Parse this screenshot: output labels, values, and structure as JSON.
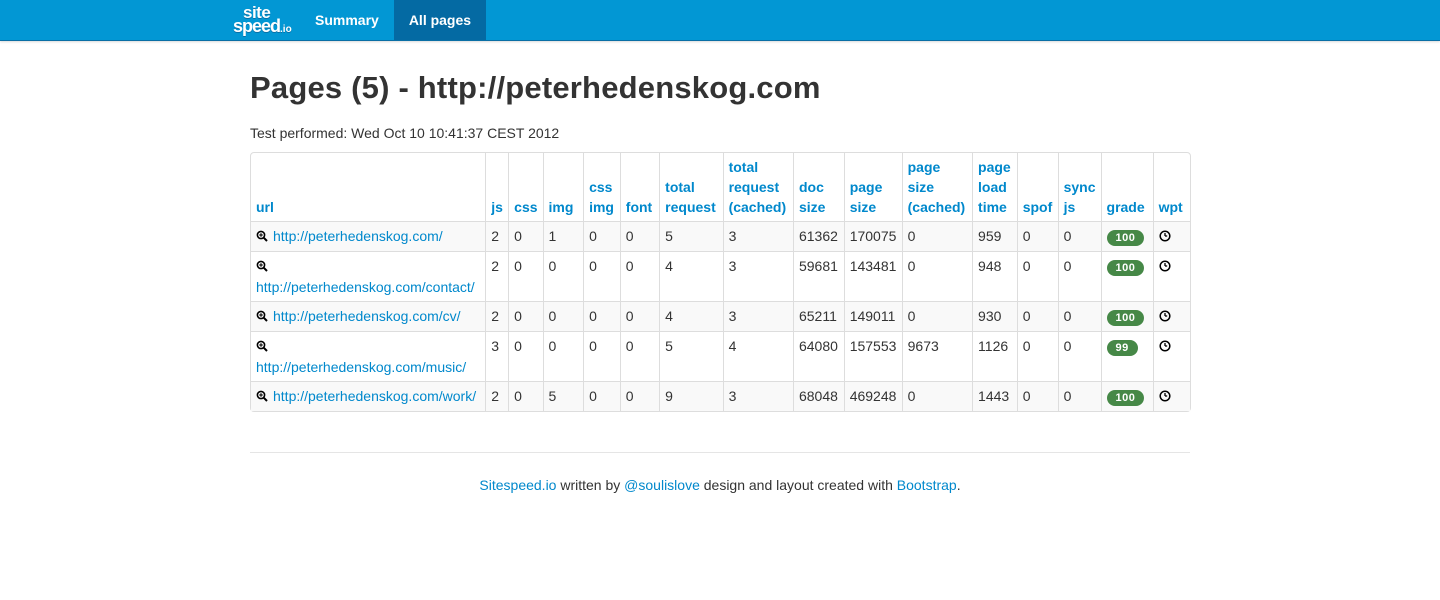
{
  "nav": {
    "brand_line1": "site",
    "brand_line2": "speed",
    "brand_suffix": ".io",
    "items": [
      {
        "label": "Summary",
        "active": false
      },
      {
        "label": "All pages",
        "active": true
      }
    ]
  },
  "page": {
    "title": "Pages (5) - http://peterhedenskog.com",
    "performed": "Test performed: Wed Oct 10 10:41:37 CEST 2012"
  },
  "table": {
    "headers": [
      "url",
      "js",
      "css",
      "img",
      "css img",
      "font",
      "total request",
      "total request (cached)",
      "doc size",
      "page size",
      "page size (cached)",
      "page load time",
      "spof",
      "sync js",
      "grade",
      "wpt"
    ],
    "rows": [
      {
        "url": "http://peterhedenskog.com/",
        "js": "2",
        "css": "0",
        "img": "1",
        "cssimg": "0",
        "font": "0",
        "total": "5",
        "cached": "3",
        "doc": "61362",
        "size": "170075",
        "sizecached": "0",
        "load": "959",
        "spof": "0",
        "sync": "0",
        "grade": "100"
      },
      {
        "url": "http://peterhedenskog.com/contact/",
        "js": "2",
        "css": "0",
        "img": "0",
        "cssimg": "0",
        "font": "0",
        "total": "4",
        "cached": "3",
        "doc": "59681",
        "size": "143481",
        "sizecached": "0",
        "load": "948",
        "spof": "0",
        "sync": "0",
        "grade": "100"
      },
      {
        "url": "http://peterhedenskog.com/cv/",
        "js": "2",
        "css": "0",
        "img": "0",
        "cssimg": "0",
        "font": "0",
        "total": "4",
        "cached": "3",
        "doc": "65211",
        "size": "149011",
        "sizecached": "0",
        "load": "930",
        "spof": "0",
        "sync": "0",
        "grade": "100"
      },
      {
        "url": "http://peterhedenskog.com/music/",
        "js": "3",
        "css": "0",
        "img": "0",
        "cssimg": "0",
        "font": "0",
        "total": "5",
        "cached": "4",
        "doc": "64080",
        "size": "157553",
        "sizecached": "9673",
        "load": "1126",
        "spof": "0",
        "sync": "0",
        "grade": "99"
      },
      {
        "url": "http://peterhedenskog.com/work/",
        "js": "2",
        "css": "0",
        "img": "5",
        "cssimg": "0",
        "font": "0",
        "total": "9",
        "cached": "3",
        "doc": "68048",
        "size": "469248",
        "sizecached": "0",
        "load": "1443",
        "spof": "0",
        "sync": "0",
        "grade": "100"
      }
    ]
  },
  "footer": {
    "link1": "Sitespeed.io",
    "text1": " written by ",
    "link2": "@soulislove",
    "text2": " design and layout created with ",
    "link3": "Bootstrap",
    "text3": "."
  },
  "icons": {
    "zoom": "zoom-in-icon",
    "wpt": "clock-icon"
  },
  "colors": {
    "navbar": "#0297d4",
    "nav_active": "#046aa3",
    "link": "#0088cc",
    "grade_badge": "#468847"
  }
}
